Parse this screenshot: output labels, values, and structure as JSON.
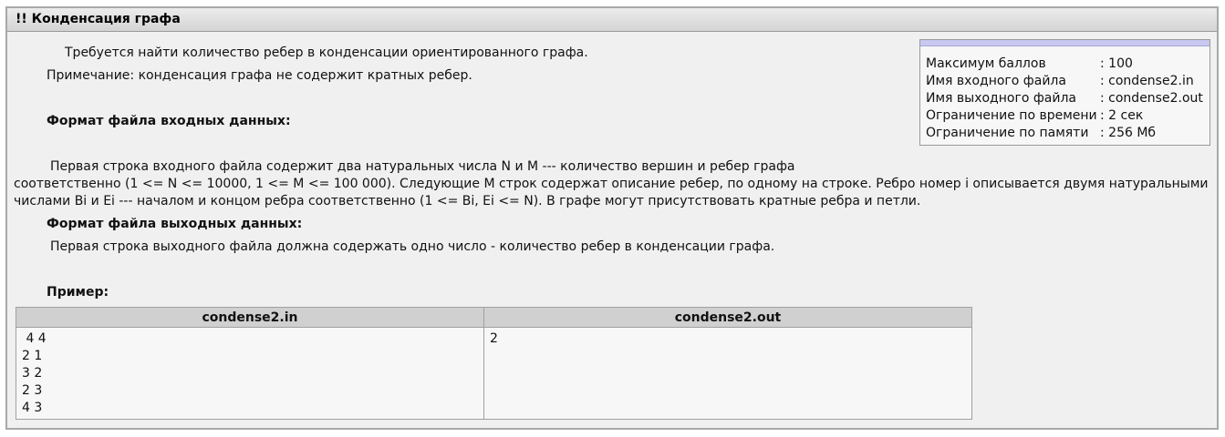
{
  "header": {
    "title": "!! Конденсация графа"
  },
  "statement": {
    "line1": "Требуется найти количество ребер в конденсации ориентированного графа.",
    "note": "Примечание: конденсация графа не содержит кратных ребер."
  },
  "input_format": {
    "heading": "Формат файла входных данных:",
    "line1": "Первая строка входного файла содержит два натуральных числа N и M --- количество вершин и ребер графа",
    "line2": "соответственно (1 <= N <= 10000, 1 <= M <= 100 000). Следующие M строк содержат описание ребер, по одному на строке. Ребро номер i описывается двумя натуральными",
    "line3": "числами Bi и Ei --- началом и концом ребра соответственно (1 <= Bi, Ei <= N). В графе могут присутствовать кратные ребра и петли."
  },
  "output_format": {
    "heading": "Формат файла выходных данных:",
    "line1": "Первая строка выходного файла должна содержать одно число - количество ребер в конденсации графа."
  },
  "example": {
    "heading": "Пример:",
    "input_header": "condense2.in",
    "output_header": "condense2.out",
    "input_lines": [
      " 4 4",
      "2 1",
      "3 2",
      "2 3",
      "4 3"
    ],
    "output_lines": [
      "2"
    ]
  },
  "info": {
    "rows": [
      {
        "key": "Максимум баллов",
        "value": ": 100"
      },
      {
        "key": "Имя входного файла",
        "value": ": condense2.in"
      },
      {
        "key": "Имя выходного файла",
        "value": ": condense2.out"
      },
      {
        "key": "Ограничение по времени",
        "value": ": 2 сек"
      },
      {
        "key": "Ограничение по памяти",
        "value": ": 256 Мб"
      }
    ]
  }
}
